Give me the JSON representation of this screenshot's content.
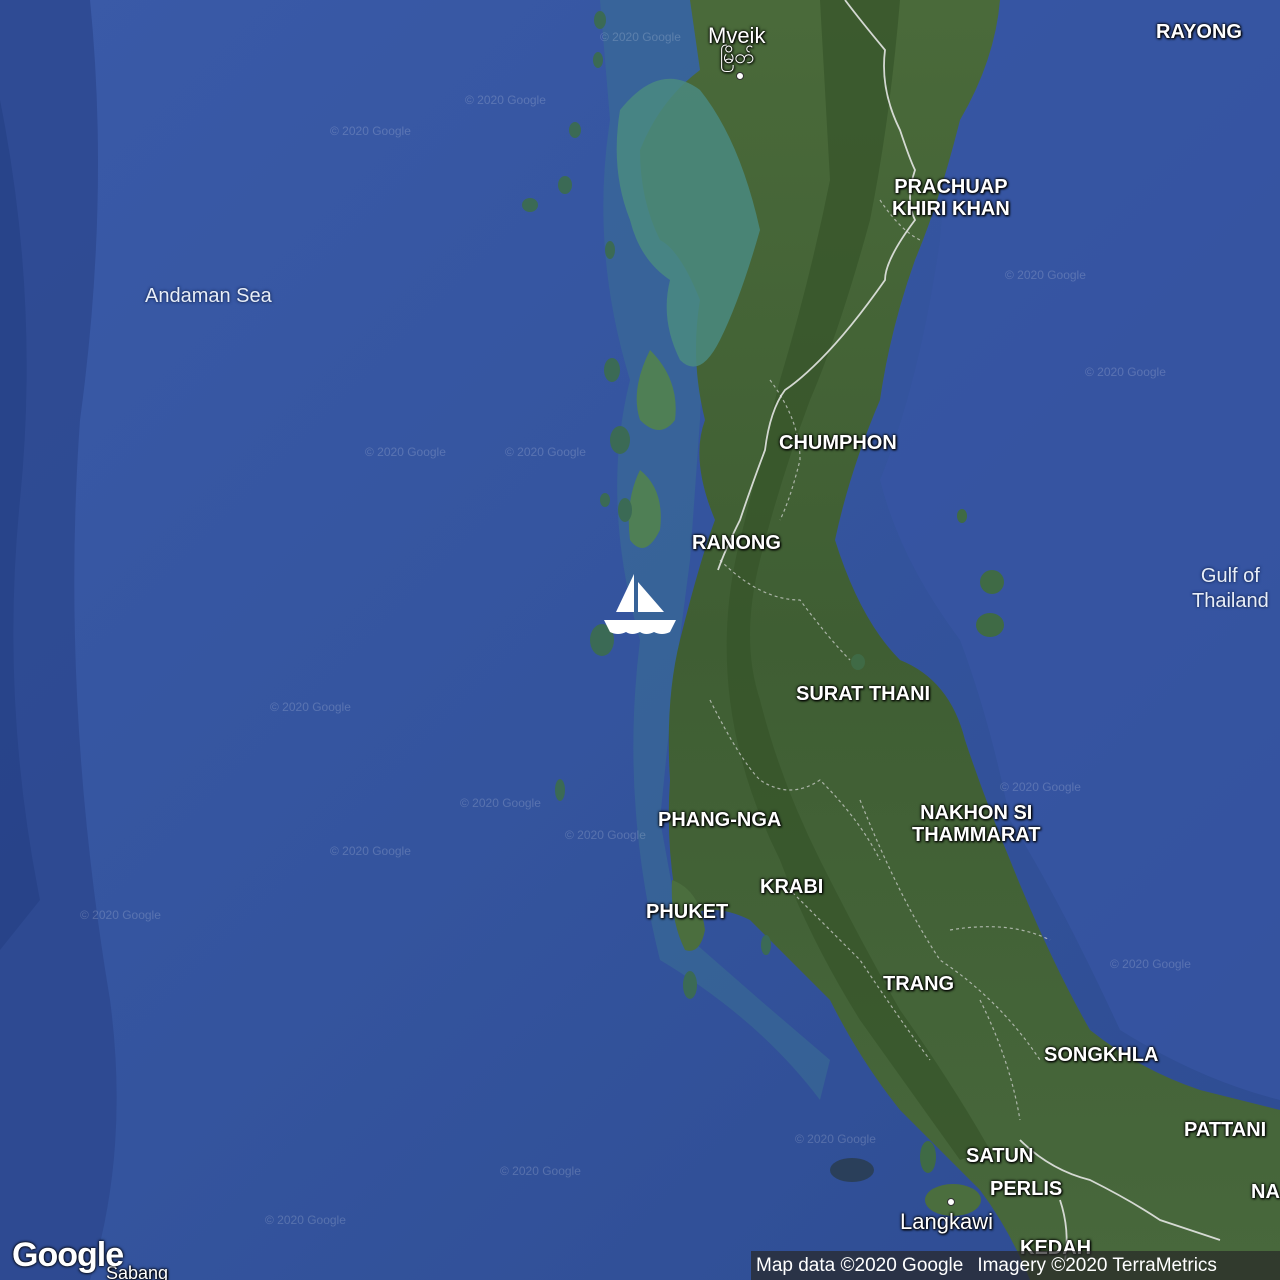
{
  "map": {
    "imagery": "satellite",
    "attribution": {
      "map_data": "Map data ©2020 Google",
      "imagery": "Imagery ©2020 TerraMetrics"
    },
    "logo": "Google",
    "watermark": "© 2020 Google",
    "marker_icon": "sailboat-icon",
    "colors": {
      "sea": "#2f4f9a",
      "land": "#3e5a32",
      "shallow": "#3f8a86",
      "label": "#ffffff"
    },
    "water_labels": {
      "andaman": "Andaman Sea",
      "gulf_line1": "Gulf of",
      "gulf_line2": "Thailand"
    },
    "places": {
      "mveik": "Mveik",
      "mveik_script": "မြိတ်",
      "rayong": "RAYONG",
      "prachuap1": "PRACHUAP",
      "prachuap2": "KHIRI KHAN",
      "chumphon": "CHUMPHON",
      "ranong": "RANONG",
      "surat": "SURAT THANI",
      "phangnga": "PHANG-NGA",
      "nakhon1": "NAKHON SI",
      "nakhon2": "THAMMARAT",
      "krabi": "KRABI",
      "phuket": "PHUKET",
      "trang": "TRANG",
      "songkhla": "SONGKHLA",
      "pattani": "PATTANI",
      "satun": "SATUN",
      "perlis": "PERLIS",
      "langkawi": "Langkawi",
      "kedah": "KEDAH",
      "na": "NA",
      "sabang": "Sabang"
    }
  }
}
